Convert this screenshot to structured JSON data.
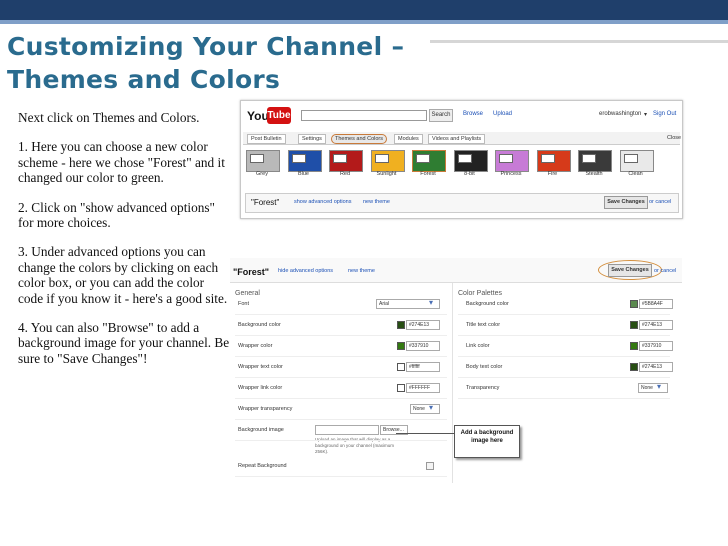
{
  "slide": {
    "title_line1": "Customizing Your Channel –",
    "title_line2": "Themes and Colors",
    "paragraphs": [
      "Next click on Themes and Colors.",
      "1. Here you can choose a new color scheme  - here we chose \"Forest\" and it changed our color to green.",
      "2. Click on \"show advanced options\" for more choices.",
      "3. Under advanced options you can change the colors by clicking on each color box, or you can add the color code if you know it - here's a good site.",
      "4. You can also \"Browse\" to add a background image for your channel. Be sure to \"Save Changes\"!"
    ]
  },
  "youtube": {
    "logo_you": "You",
    "logo_tube": "Tube",
    "search_label": "Search",
    "browse": "Browse",
    "upload": "Upload",
    "user": "erobwashington",
    "sign_out": "Sign Out",
    "close": "Close",
    "tabs": [
      "Post Bulletin",
      "Settings",
      "Themes and Colors",
      "Modules",
      "Videos and Playlists"
    ],
    "themes": [
      {
        "name": "Grey",
        "color": "#b9b9b9"
      },
      {
        "name": "Blue",
        "color": "#1f4fa8"
      },
      {
        "name": "Red",
        "color": "#b31a1a"
      },
      {
        "name": "Sunlight",
        "color": "#f0b020"
      },
      {
        "name": "Forest",
        "color": "#2f7d32"
      },
      {
        "name": "8-bit",
        "color": "#222222"
      },
      {
        "name": "Princess",
        "color": "#c77bd6"
      },
      {
        "name": "Fire",
        "color": "#d63a1a"
      },
      {
        "name": "Stealth",
        "color": "#3a3a3a"
      },
      {
        "name": "Clean",
        "color": "#e9e9e9"
      }
    ],
    "selected_theme": "\"Forest\"",
    "show_advanced": "show advanced options",
    "new_theme": "new theme",
    "save_changes": "Save Changes",
    "or_cancel": "or cancel"
  },
  "advanced": {
    "theme_label": "\"Forest\"",
    "hide_advanced": "hide advanced options",
    "new_theme": "new theme",
    "save_changes": "Save Changes",
    "or_cancel": "or cancel",
    "general_title": "General",
    "palettes_title": "Color Palettes",
    "general_rows": [
      {
        "label": "Font",
        "value": "Arial",
        "kind": "select"
      },
      {
        "label": "Background color",
        "value": "#274E13",
        "kind": "color",
        "color": "#274e13"
      },
      {
        "label": "Wrapper color",
        "value": "#337910",
        "kind": "color",
        "color": "#337910"
      },
      {
        "label": "Wrapper text color",
        "value": "#ffffff",
        "kind": "color",
        "color": "#ffffff"
      },
      {
        "label": "Wrapper link color",
        "value": "#FFFFFF",
        "kind": "color",
        "color": "#ffffff"
      },
      {
        "label": "Wrapper transparency",
        "value": "None",
        "kind": "select"
      },
      {
        "label": "Background image",
        "value": "Browse...",
        "kind": "file"
      },
      {
        "label": "Repeat Background",
        "value": "",
        "kind": "checkbox"
      }
    ],
    "upload_note": "Upload an image that will display as a background on your channel (maximum 256K).",
    "palette_rows": [
      {
        "label": "Background color",
        "value": "#5B8A4F",
        "color": "#5b8a4f"
      },
      {
        "label": "Title text color",
        "value": "#274E13",
        "color": "#274e13"
      },
      {
        "label": "Link color",
        "value": "#337910",
        "color": "#337910"
      },
      {
        "label": "Body text color",
        "value": "#274E13",
        "color": "#274e13"
      },
      {
        "label": "Transparency",
        "value": "None",
        "kind": "select"
      }
    ],
    "callout": "Add a background image here"
  }
}
